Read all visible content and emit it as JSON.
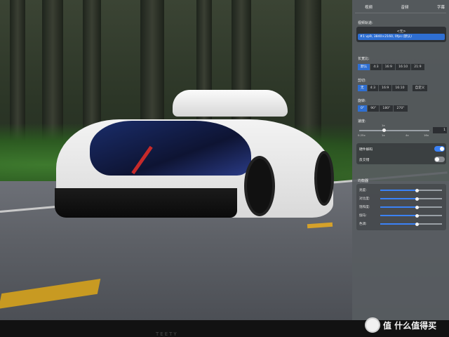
{
  "panel": {
    "tabs": [
      "视频",
      "音频",
      "字幕"
    ],
    "track": {
      "label": "视频轨道:",
      "none": "<无>",
      "selected": "#1  vp9, 3840×2160, 0fps (默认)"
    },
    "aspect": {
      "label": "长宽比:",
      "options": [
        "默认",
        "4:3",
        "16:9",
        "16:10",
        "21:9"
      ],
      "selected": "默认"
    },
    "crop": {
      "label": "剪切:",
      "options": [
        "无",
        "4:3",
        "16:9",
        "16:10"
      ],
      "extra": "自定义",
      "selected": "无"
    },
    "rotate": {
      "label": "旋转:",
      "options": [
        "0°",
        "90°",
        "180°",
        "270°"
      ],
      "selected": "0°"
    },
    "speed": {
      "label": "速度:",
      "ticks": [
        "0.25x",
        "1x",
        "4x",
        "16x"
      ],
      "value": "1",
      "top_tick": "1x",
      "fraction": 0.35
    },
    "toggles": [
      {
        "label": "硬件解码",
        "on": true
      },
      {
        "label": "反交错",
        "on": false
      }
    ],
    "equalizer": {
      "label": "均衡器",
      "items": [
        {
          "label": "亮度:",
          "fraction": 0.6
        },
        {
          "label": "对比度:",
          "fraction": 0.6
        },
        {
          "label": "饱和度:",
          "fraction": 0.6
        },
        {
          "label": "伽马:",
          "fraction": 0.6
        },
        {
          "label": "色调:",
          "fraction": 0.6
        }
      ]
    }
  },
  "watermark": {
    "text": "值 什么值得买"
  },
  "bezel_brand": "TEETY",
  "colors": {
    "accent": "#3b82f6",
    "panel": "#585c60"
  }
}
